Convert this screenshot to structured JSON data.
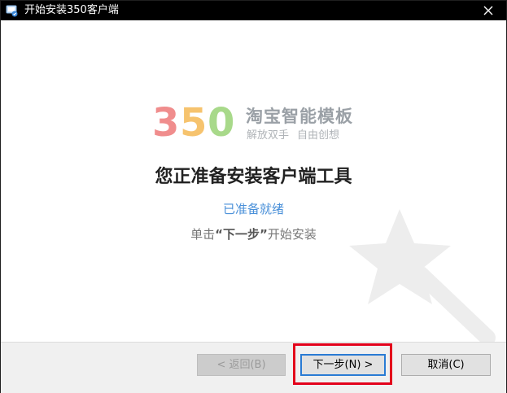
{
  "window": {
    "title": "开始安装350客户端",
    "close_glyph": "✕"
  },
  "brand": {
    "logo_text": "350",
    "logo_colors": [
      "#f08d8d",
      "#f6c36e",
      "#a8d98a"
    ],
    "name": "淘宝智能模板",
    "slogan_left": "解放双手",
    "slogan_right": "自由创想"
  },
  "main": {
    "heading": "您正准备安装客户端工具",
    "status": "已准备就绪",
    "instruction_prefix": "单击",
    "instruction_emphasis": "“下一步”",
    "instruction_suffix": "开始安装"
  },
  "buttons": {
    "back": "< 返回(B)",
    "next": "下一步(N) >",
    "cancel": "取消(C)"
  },
  "colors": {
    "titlebar": "#000000",
    "accent_blue": "#4a90d9",
    "highlight_red": "#e3001b"
  },
  "icons": {
    "app": "installer-icon",
    "close": "close-icon",
    "decoration": "magic-wand-icon"
  }
}
